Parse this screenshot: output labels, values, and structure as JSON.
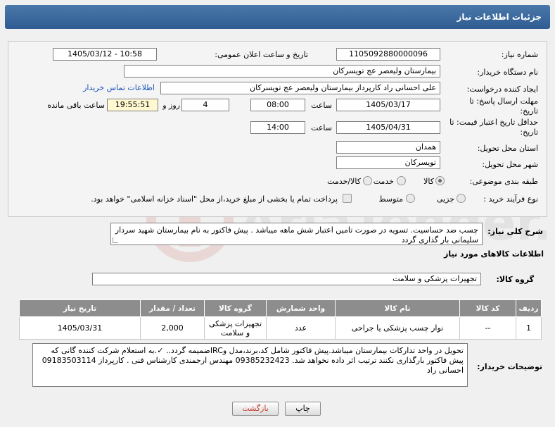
{
  "header": {
    "title": "جزئیات اطلاعات نیاز"
  },
  "form": {
    "need_number_label": "شماره نیاز:",
    "need_number": "1105092880000096",
    "announce_label": "تاریخ و ساعت اعلان عمومی:",
    "announce_value": "1405/03/12 - 10:58",
    "buyer_org_label": "نام دستگاه خریدار:",
    "buyer_org": "بیمارستان ولیعصر  عج  تویسرکان",
    "creator_label": "ایجاد کننده درخواست:",
    "creator": "علی احسانی راد کارپرداز بیمارستان ولیعصر  عج  تویسرکان",
    "contact_link": "اطلاعات تماس خریدار",
    "reply_deadline_label": "مهلت ارسال پاسخ: تا تاریخ:",
    "reply_date": "1405/03/17",
    "hour_label": "ساعت",
    "reply_time": "08:00",
    "days_value": "4",
    "days_label": "روز و",
    "remaining_time": "19:55:51",
    "remaining_label": "ساعت باقی مانده",
    "validity_label": "حداقل تاریخ اعتبار قیمت: تا تاریخ:",
    "validity_date": "1405/04/31",
    "validity_hour_label": "ساعت",
    "validity_time": "14:00",
    "province_label": "استان محل تحویل:",
    "province": "همدان",
    "city_label": "شهر محل تحویل:",
    "city": "تویسرکان",
    "category_label": "طبقه بندی موضوعی:",
    "category_options": [
      "کالا",
      "خدمت",
      "کالا/خدمت"
    ],
    "process_label": "نوع فرآیند خرید :",
    "process_options": [
      "جزیی",
      "متوسط"
    ],
    "payment_note": "پرداخت تمام یا بخشی از مبلغ خرید،از محل \"اسناد خزانه اسلامی\" خواهد بود."
  },
  "summary": {
    "label": "شرح کلی نیاز:",
    "text": "چسب ضد حساسیت. تسویه در صورت تامین اعتبار شش ماهه میباشد . پیش فاکتور به نام بیمارستان شهید سردار سلیمانی بار گذاری گردد"
  },
  "goods": {
    "section_title": "اطلاعات کالاهای مورد نیاز",
    "group_label": "گروه کالا:",
    "group_value": "تجهیزات پزشکی و سلامت",
    "columns": [
      "ردیف",
      "کد کالا",
      "نام کالا",
      "واحد شمارش",
      "گروه کالا",
      "تعداد / مقدار",
      "تاریخ نیاز"
    ],
    "rows": [
      {
        "row": "1",
        "code": "--",
        "name": "نوار چسب پزشکی یا جراحی",
        "unit": "عدد",
        "group": "تجهیزات پزشکی و سلامت",
        "qty": "2,000",
        "date": "1405/03/31"
      }
    ]
  },
  "buyer_notes": {
    "label": "توضیحات خریدار:",
    "text": "تحویل در واحد تدارکات بیمارستان میباشد.پیش فاکتور شامل کد،برند،مدل وIRCضمیمه گردد.. ✓.به استعلام شرکت کننده گانی که پیش فاکتور بارگذاری نکنند ترتیب اثر داده نخواهد شد. 09385232423 مهندس ارجمندی کارشناس فنی . کارپرداز 09183503114 احسانی راد"
  },
  "buttons": {
    "print": "چاپ",
    "back": "بازگشت"
  },
  "watermark": {
    "text": "AriaTender.net"
  }
}
